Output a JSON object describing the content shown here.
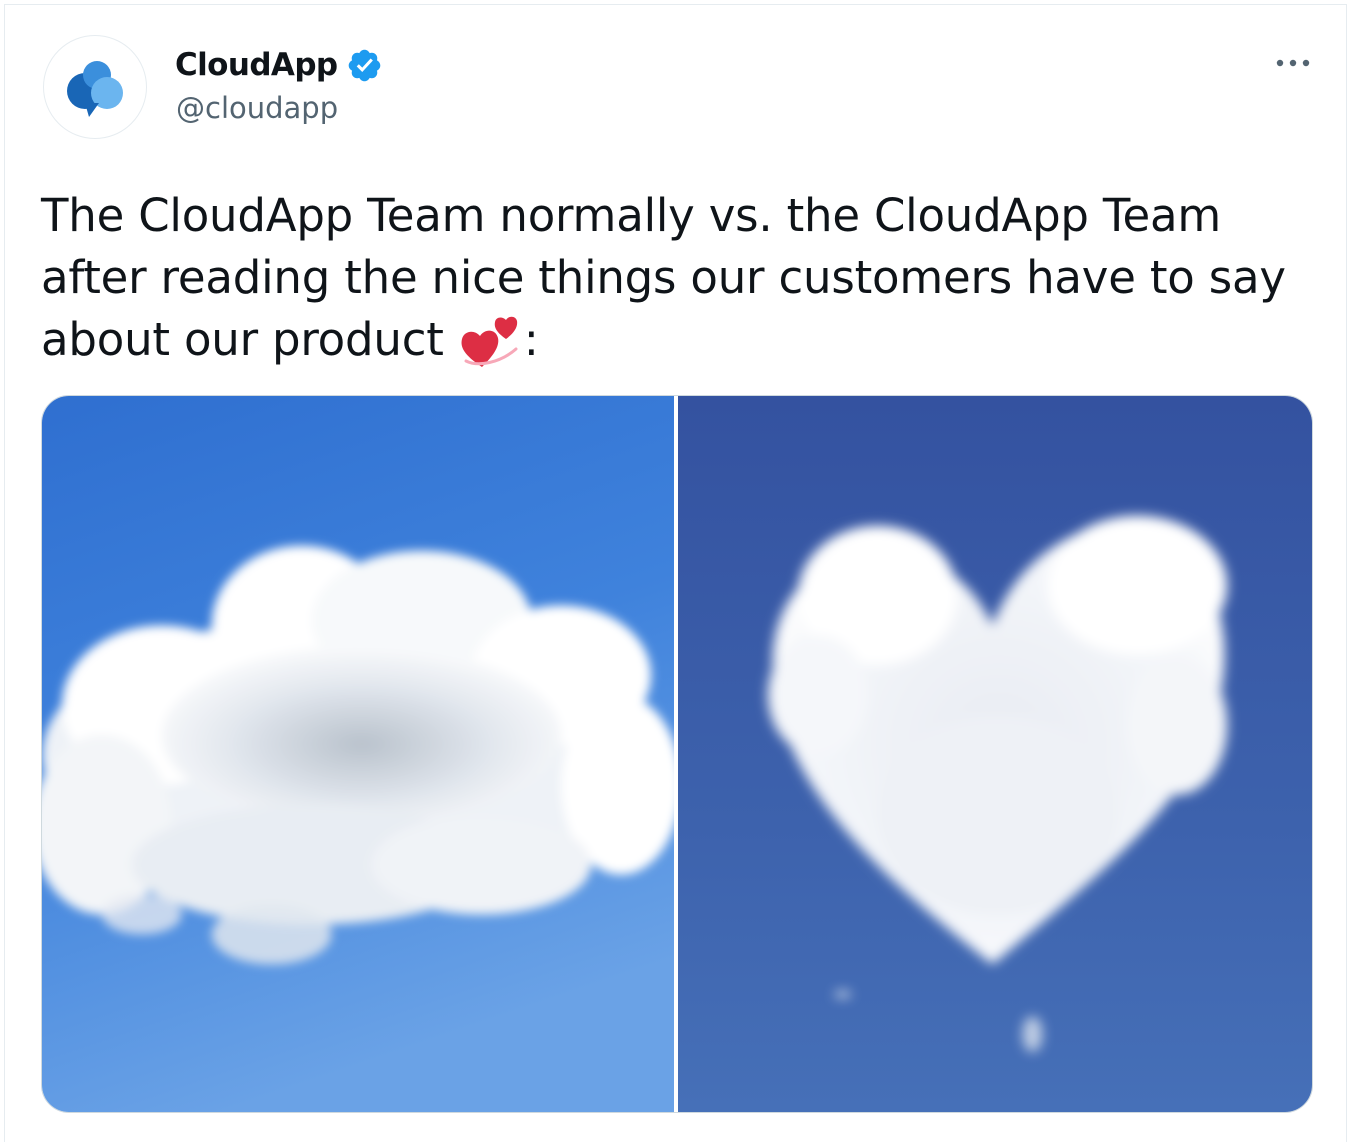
{
  "tweet": {
    "display_name": "CloudApp",
    "handle": "@cloudapp",
    "verified": true,
    "more_icon": "more-horizontal-icon",
    "text_main": "The CloudApp Team normally vs. the CloudApp Team after reading the nice things our customers have to say about our product ",
    "text_emoji": "two-hearts-emoji",
    "text_tail": ":",
    "media": [
      {
        "subject": "cloud",
        "sky_color": "#3f7fd6"
      },
      {
        "subject": "heart-shaped-cloud",
        "sky_color": "#3a5ea8"
      }
    ]
  },
  "colors": {
    "text": "#0f1419",
    "secondary_text": "#536471",
    "verified_blue": "#1d9bf0",
    "logo_dark": "#1966b6",
    "logo_light": "#6bb5ef",
    "heart_red": "#dd2e44"
  }
}
